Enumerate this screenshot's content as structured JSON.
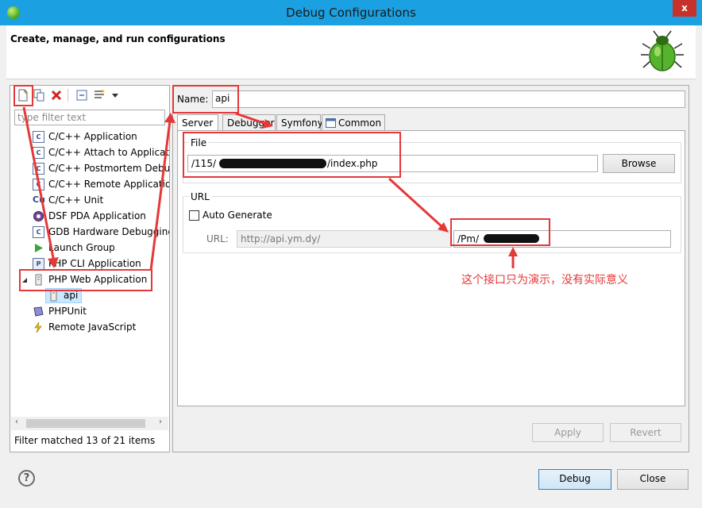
{
  "window": {
    "title": "Debug Configurations",
    "close_label": "x",
    "icon": "green-bug-icon"
  },
  "banner": {
    "text": "Create, manage, and run configurations",
    "icon": "bug-icon"
  },
  "left": {
    "toolbar": [
      "new-config-icon",
      "duplicate-icon",
      "delete-icon",
      "collapse-all-icon",
      "filter-icon",
      "view-menu-icon"
    ],
    "filter_placeholder": "type filter text",
    "tree": [
      {
        "label": "C/C++ Application",
        "icon": "c-app-icon"
      },
      {
        "label": "C/C++ Attach to Application",
        "icon": "c-attach-icon"
      },
      {
        "label": "C/C++ Postmortem Debugger",
        "icon": "c-postmortem-icon"
      },
      {
        "label": "C/C++ Remote Application",
        "icon": "c-remote-icon"
      },
      {
        "label": "C/C++ Unit",
        "icon": "c-unit-icon"
      },
      {
        "label": "DSF PDA Application",
        "icon": "pda-icon"
      },
      {
        "label": "GDB Hardware Debugging",
        "icon": "gdb-icon"
      },
      {
        "label": "Launch Group",
        "icon": "launch-group-icon"
      },
      {
        "label": "PHP CLI Application",
        "icon": "php-cli-icon"
      },
      {
        "label": "PHP Web Application",
        "icon": "php-web-icon"
      },
      {
        "label": "api",
        "icon": "php-web-config-icon"
      },
      {
        "label": "PHPUnit",
        "icon": "phpunit-icon"
      },
      {
        "label": "Remote JavaScript",
        "icon": "remote-js-icon"
      }
    ],
    "status": "Filter matched 13 of 21 items"
  },
  "right": {
    "name_label": "Name:",
    "name_value": "api",
    "tabs": [
      "Server",
      "Debugger",
      "Symfony",
      "Common"
    ],
    "file_group_label": "File",
    "file_value_start": "/115/",
    "file_value_end": "/index.php",
    "browse_label": "Browse",
    "url_group_label": "URL",
    "auto_generate_label": "Auto Generate",
    "url_label": "URL:",
    "url_base": "http://api.ym.dy/",
    "url_path_start": "/Pm/",
    "apply_label": "Apply",
    "revert_label": "Revert"
  },
  "bottom": {
    "help": "?",
    "debug_label": "Debug",
    "close_label": "Close"
  },
  "annotation": {
    "text": "这个接口只为演示，没有实际意义",
    "color": "#e53838"
  }
}
